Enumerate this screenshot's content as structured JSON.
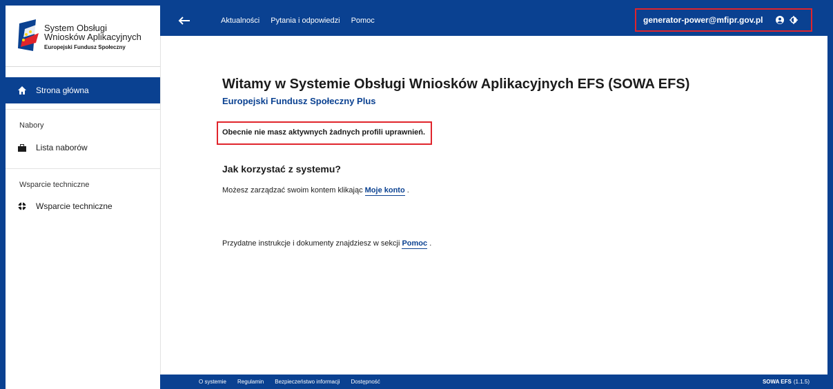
{
  "app": {
    "logo_line1": "System Obsługi",
    "logo_line2": "Wniosków Aplikacyjnych",
    "logo_line3": "Europejski Fundusz Społeczny"
  },
  "topbar": {
    "nav": [
      "Aktualności",
      "Pytania i odpowiedzi",
      "Pomoc"
    ],
    "user_email": "generator-power@mfipr.gov.pl"
  },
  "sidebar": {
    "active_item": "Strona główna",
    "sections": [
      {
        "title": "Nabory",
        "items": [
          "Lista naborów"
        ]
      },
      {
        "title": "Wsparcie techniczne",
        "items": [
          "Wsparcie techniczne"
        ]
      }
    ]
  },
  "main": {
    "title": "Witamy w Systemie Obsługi Wniosków Aplikacyjnych EFS (SOWA EFS)",
    "subtitle": "Europejski Fundusz Społeczny Plus",
    "notice": "Obecnie nie masz aktywnych żadnych profili uprawnień.",
    "howto_title": "Jak korzystać z systemu?",
    "para1_prefix": "Możesz zarządzać swoim kontem klikając",
    "para1_link": "Moje konto",
    "para1_suffix": ".",
    "para2_prefix": "Przydatne instrukcje i dokumenty znajdziesz w sekcji",
    "para2_link": "Pomoc",
    "para2_suffix": "."
  },
  "footer": {
    "links": [
      "O systemie",
      "Regulamin",
      "Bezpieczeństwo informacji",
      "Dostępność"
    ],
    "version_name": "SOWA EFS",
    "version_number": "(1.1.5)"
  },
  "icons": {
    "back": "arrow-left-icon",
    "user": "user-circle-icon",
    "contrast": "contrast-icon",
    "home": "home-icon",
    "list": "briefcase-icon",
    "support": "lifebuoy-icon"
  },
  "colors": {
    "brand": "#0a4191",
    "highlight": "#e0242b"
  }
}
